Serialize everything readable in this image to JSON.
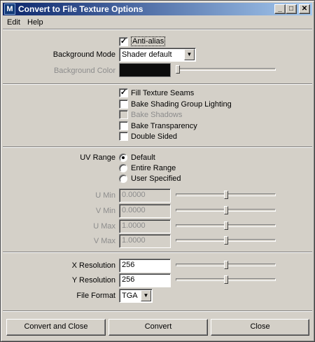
{
  "window": {
    "title": "Convert to File Texture Options",
    "icon_glyph": "M",
    "minimize_glyph": "_",
    "maximize_glyph": "□",
    "close_glyph": "✕"
  },
  "menu": [
    "Edit",
    "Help"
  ],
  "general": {
    "anti_alias": {
      "label": "Anti-alias",
      "checked": true
    },
    "background_mode": {
      "label": "Background Mode",
      "value": "Shader default"
    },
    "background_color": {
      "label": "Background Color",
      "color": "#0c0c0c",
      "slider_level": 0.0
    }
  },
  "options": [
    {
      "label": "Fill Texture Seams",
      "checked": true,
      "enabled": true
    },
    {
      "label": "Bake Shading Group Lighting",
      "checked": false,
      "enabled": true
    },
    {
      "label": "Bake Shadows",
      "checked": false,
      "enabled": false
    },
    {
      "label": "Bake Transparency",
      "checked": false,
      "enabled": true
    },
    {
      "label": "Double Sided",
      "checked": false,
      "enabled": true
    }
  ],
  "uv_range": {
    "label": "UV Range",
    "options": [
      {
        "label": "Default",
        "selected": true
      },
      {
        "label": "Entire Range",
        "selected": false
      },
      {
        "label": "User Specified",
        "selected": false
      }
    ],
    "fields": [
      {
        "label": "U Min",
        "value": "0.0000",
        "slider_level": 0.5
      },
      {
        "label": "V Min",
        "value": "0.0000",
        "slider_level": 0.5
      },
      {
        "label": "U Max",
        "value": "1.0000",
        "slider_level": 0.5
      },
      {
        "label": "V Max",
        "value": "1.0000",
        "slider_level": 0.5
      }
    ]
  },
  "output": {
    "x_resolution": {
      "label": "X Resolution",
      "value": "256",
      "slider_level": 0.5
    },
    "y_resolution": {
      "label": "Y Resolution",
      "value": "256",
      "slider_level": 0.5
    },
    "file_format": {
      "label": "File Format",
      "value": "TGA"
    }
  },
  "buttons": {
    "convert_close": "Convert and Close",
    "convert": "Convert",
    "close": "Close"
  },
  "glyphs": {
    "check": "✓",
    "dropdown": "▼"
  }
}
